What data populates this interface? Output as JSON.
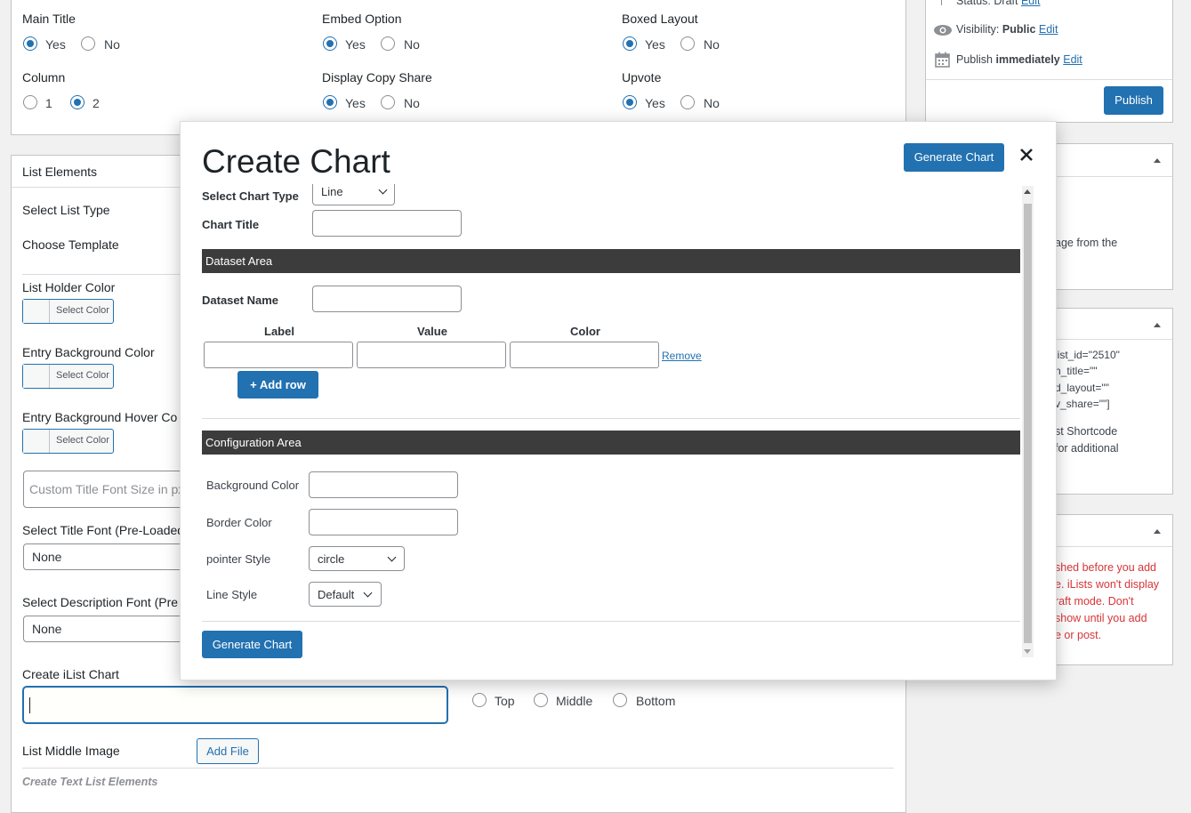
{
  "settings": {
    "main_title": {
      "label": "Main Title",
      "yes": "Yes",
      "no": "No"
    },
    "embed_option": {
      "label": "Embed Option",
      "yes": "Yes",
      "no": "No"
    },
    "boxed_layout": {
      "label": "Boxed Layout",
      "yes": "Yes",
      "no": "No"
    },
    "column": {
      "label": "Column",
      "opt1": "1",
      "opt2": "2"
    },
    "display_copy_share": {
      "label": "Display Copy Share",
      "yes": "Yes",
      "no": "No"
    },
    "upvote": {
      "label": "Upvote",
      "yes": "Yes",
      "no": "No"
    }
  },
  "list_elements": {
    "title": "List Elements",
    "select_list_type": "Select List Type",
    "choose_template": "Choose Template",
    "list_holder_color": "List Holder Color",
    "entry_bg_color": "Entry Background Color",
    "entry_bg_hover": "Entry Background Hover Co",
    "select_color": "Select Color",
    "font_size_placeholder": "Custom Title Font Size in px",
    "title_font": "Select Title Font (Pre-Loaded",
    "title_font_value": "None",
    "desc_font": "Select Description Font (Pre",
    "desc_font_value": "None",
    "create_chart": "Create iList Chart",
    "pos_top": "Top",
    "pos_middle": "Middle",
    "pos_bottom": "Bottom",
    "middle_image": "List Middle Image",
    "add_file": "Add File",
    "create_text": "Create Text List Elements"
  },
  "sidebar": {
    "status": "Status: Draft",
    "status_edit": "Edit",
    "visibility": "Visibility:",
    "visibility_value": "Public",
    "visibility_edit": "Edit",
    "publish_label": "Publish",
    "publish_value": "immediately",
    "publish_edit": "Edit",
    "publish_button": "Publish",
    "box2_text": "age from the",
    "shortcode": [
      "list_id=\"2510\"",
      "n_title=\"\"",
      "d_layout=\"\"",
      "v_share=\"\"]"
    ],
    "shortcode_note": [
      "st Shortcode",
      "for additional"
    ],
    "warning": [
      "shed before you add",
      "e. iLists won't display",
      "raft mode. Don't",
      "show until you add",
      "e or post."
    ]
  },
  "modal": {
    "title": "Create Chart",
    "generate_top": "Generate Chart",
    "chart_type_label": "Select Chart Type",
    "chart_type_value": "Line",
    "chart_title_label": "Chart Title",
    "dataset_area": "Dataset Area",
    "dataset_name_label": "Dataset Name",
    "col_label": "Label",
    "col_value": "Value",
    "col_color": "Color",
    "remove": "Remove",
    "add_row": "+ Add row",
    "config_area": "Configuration Area",
    "bg_color": "Background Color",
    "border_color": "Border Color",
    "pointer_style": "pointer Style",
    "pointer_value": "circle",
    "line_style": "Line Style",
    "line_value": "Default",
    "generate_bottom": "Generate Chart"
  },
  "colors": {
    "accent": "#2271b1",
    "dark_bar": "#3c3c3c",
    "warning": "#d63638"
  }
}
